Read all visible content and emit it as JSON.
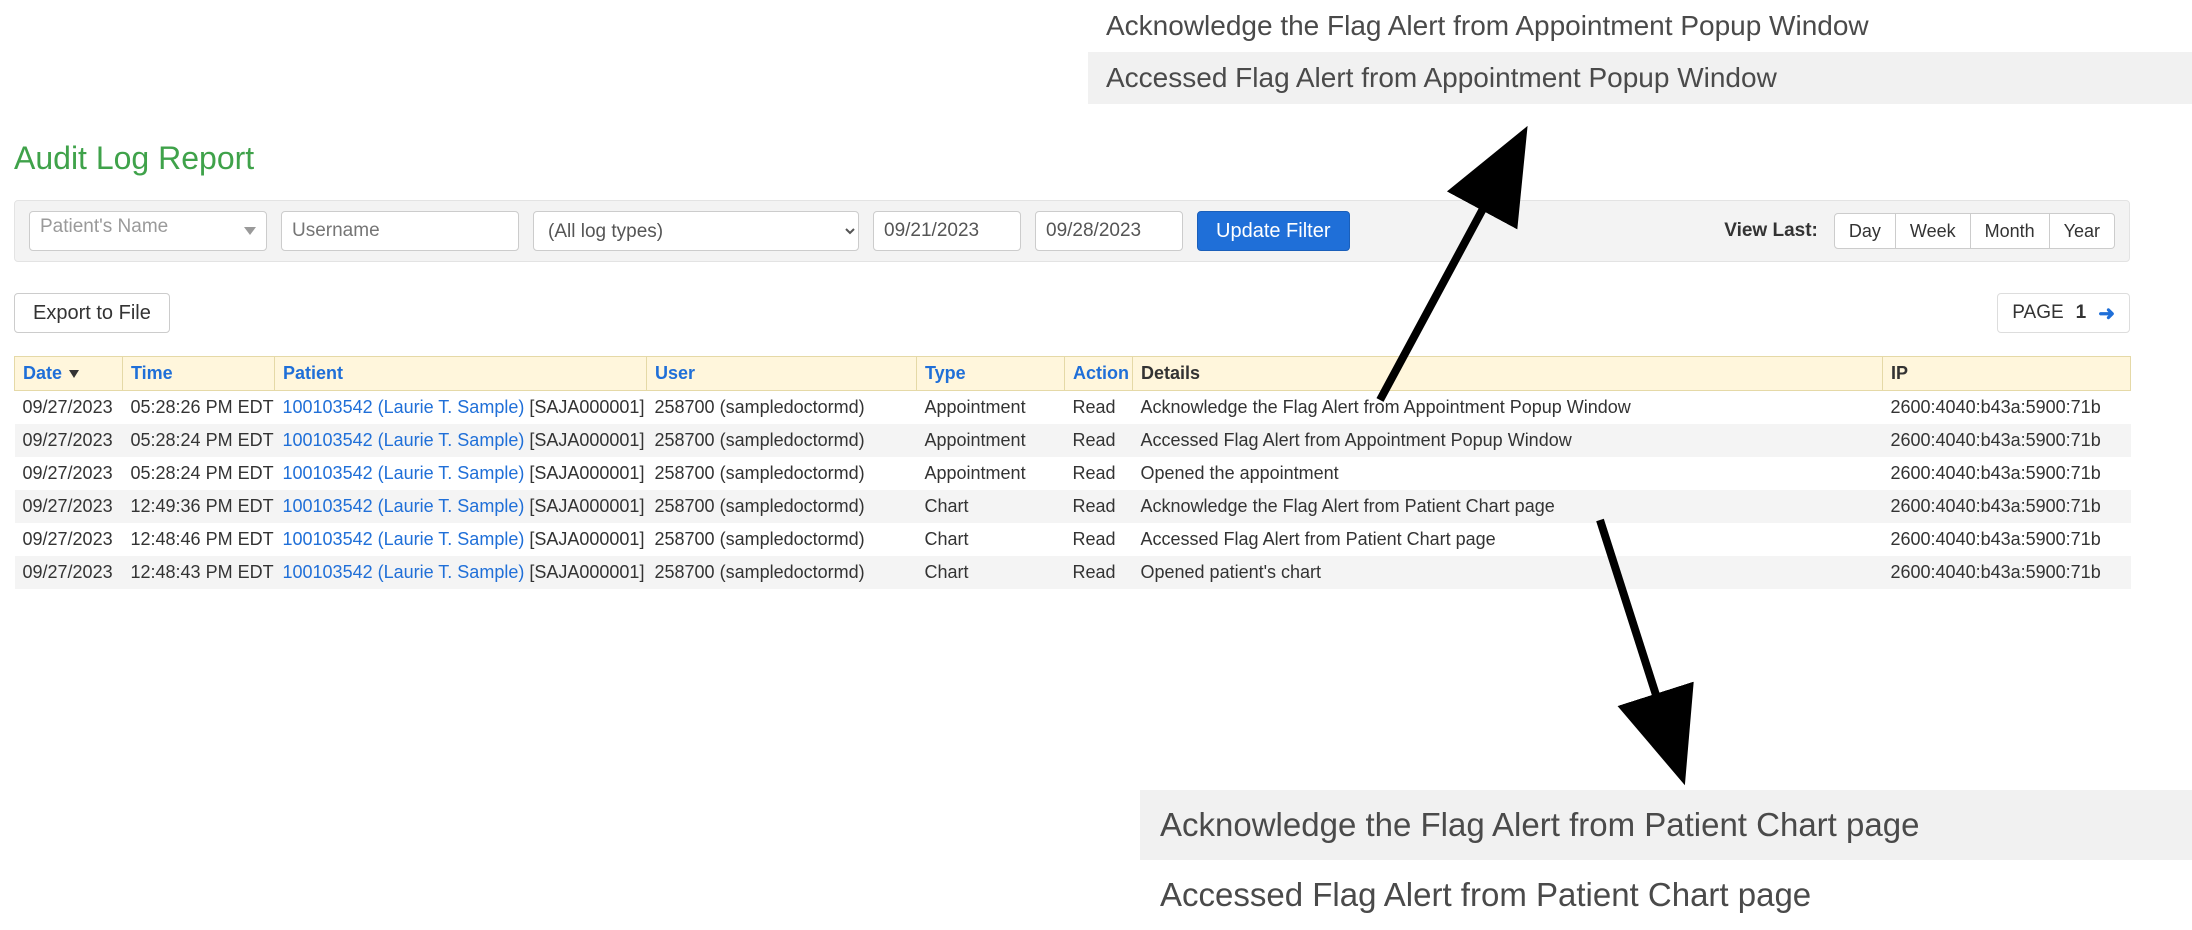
{
  "callout_top": {
    "line1": "Acknowledge the Flag Alert from Appointment Popup Window",
    "line2": "Accessed Flag Alert from Appointment Popup Window"
  },
  "callout_bottom": {
    "line1": "Acknowledge the Flag Alert from Patient Chart page",
    "line2": "Accessed Flag Alert from Patient Chart page"
  },
  "title": "Audit Log Report",
  "filters": {
    "patient_placeholder": "Patient's Name",
    "username_placeholder": "Username",
    "logtype_selected": "(All log types)",
    "date_start": "09/21/2023",
    "date_end": "09/28/2023",
    "update_label": "Update Filter",
    "viewlast_label": "View Last:",
    "viewlast_options": {
      "day": "Day",
      "week": "Week",
      "month": "Month",
      "year": "Year"
    }
  },
  "toolbar": {
    "export_label": "Export to File",
    "page_label": "PAGE",
    "page_number": "1"
  },
  "columns": {
    "date": "Date",
    "time": "Time",
    "patient": "Patient",
    "user": "User",
    "type": "Type",
    "action": "Action",
    "details": "Details",
    "ip": "IP"
  },
  "rows": [
    {
      "date": "09/27/2023",
      "time": "05:28:26 PM EDT",
      "patient_link": "100103542 (Laurie T. Sample)",
      "patient_code": "[SAJA000001]",
      "user_id": "258700",
      "user_name": "(sampledoctormd)",
      "type": "Appointment",
      "action": "Read",
      "details": "Acknowledge the Flag Alert from Appointment Popup Window",
      "ip": "2600:4040:b43a:5900:71b"
    },
    {
      "date": "09/27/2023",
      "time": "05:28:24 PM EDT",
      "patient_link": "100103542 (Laurie T. Sample)",
      "patient_code": "[SAJA000001]",
      "user_id": "258700",
      "user_name": "(sampledoctormd)",
      "type": "Appointment",
      "action": "Read",
      "details": "Accessed Flag Alert from Appointment Popup Window",
      "ip": "2600:4040:b43a:5900:71b"
    },
    {
      "date": "09/27/2023",
      "time": "05:28:24 PM EDT",
      "patient_link": "100103542 (Laurie T. Sample)",
      "patient_code": "[SAJA000001]",
      "user_id": "258700",
      "user_name": "(sampledoctormd)",
      "type": "Appointment",
      "action": "Read",
      "details": "Opened the appointment",
      "ip": "2600:4040:b43a:5900:71b"
    },
    {
      "date": "09/27/2023",
      "time": "12:49:36 PM EDT",
      "patient_link": "100103542 (Laurie T. Sample)",
      "patient_code": "[SAJA000001]",
      "user_id": "258700",
      "user_name": "(sampledoctormd)",
      "type": "Chart",
      "action": "Read",
      "details": "Acknowledge the Flag Alert from Patient Chart page",
      "ip": "2600:4040:b43a:5900:71b"
    },
    {
      "date": "09/27/2023",
      "time": "12:48:46 PM EDT",
      "patient_link": "100103542 (Laurie T. Sample)",
      "patient_code": "[SAJA000001]",
      "user_id": "258700",
      "user_name": "(sampledoctormd)",
      "type": "Chart",
      "action": "Read",
      "details": "Accessed Flag Alert from Patient Chart page",
      "ip": "2600:4040:b43a:5900:71b"
    },
    {
      "date": "09/27/2023",
      "time": "12:48:43 PM EDT",
      "patient_link": "100103542 (Laurie T. Sample)",
      "patient_code": "[SAJA000001]",
      "user_id": "258700",
      "user_name": "(sampledoctormd)",
      "type": "Chart",
      "action": "Read",
      "details": "Opened patient's chart",
      "ip": "2600:4040:b43a:5900:71b"
    }
  ]
}
